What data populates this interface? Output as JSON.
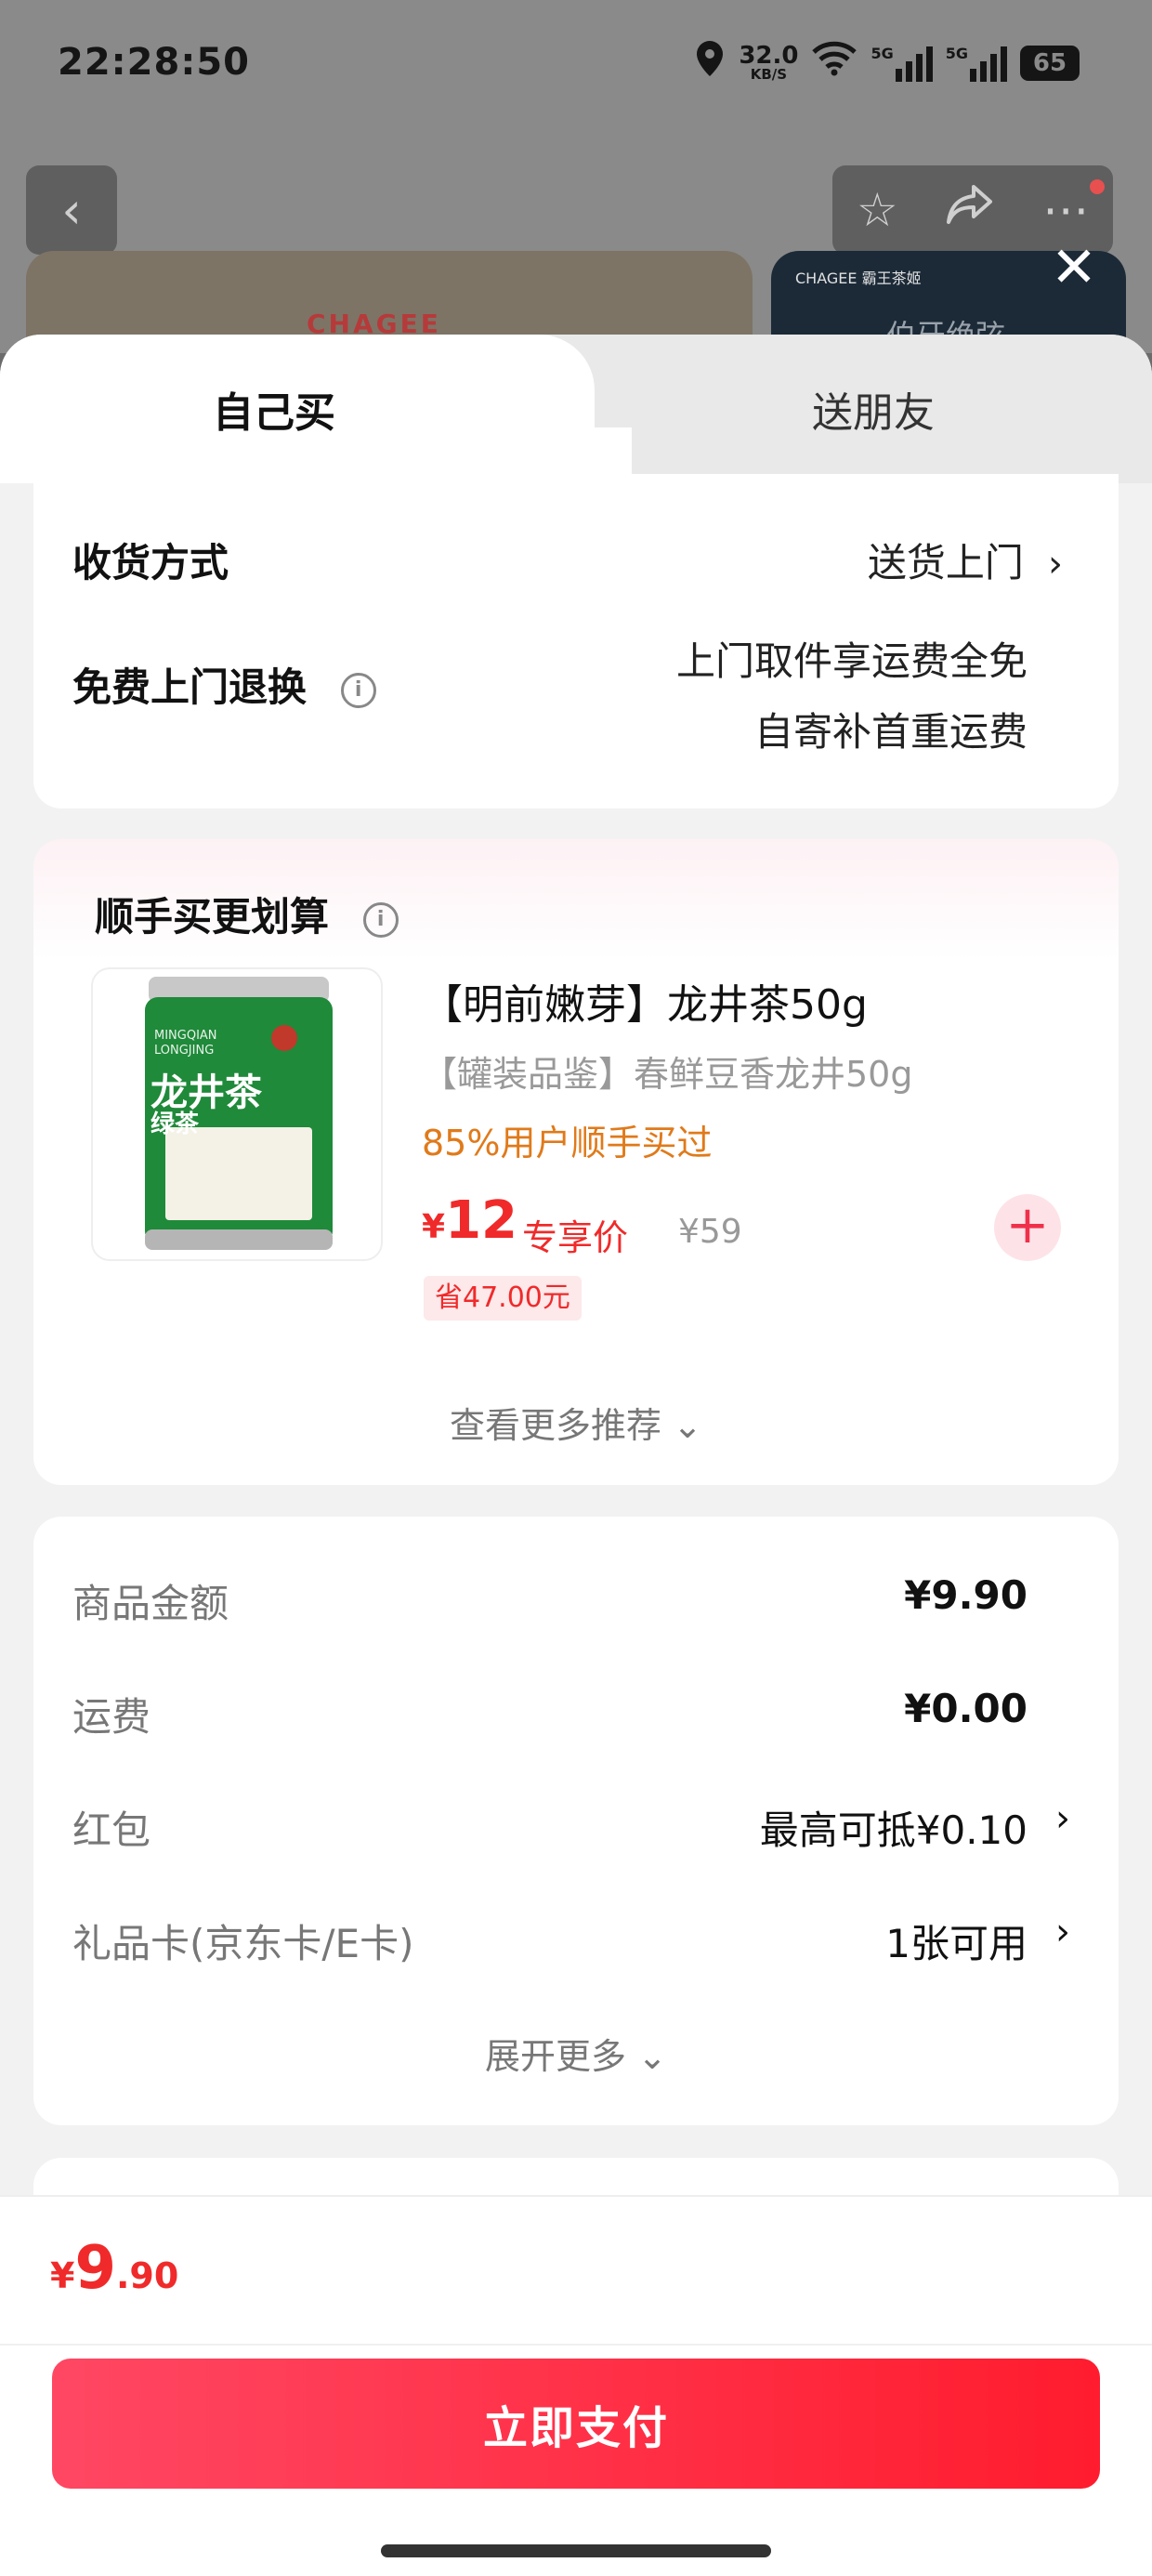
{
  "status_bar": {
    "time": "22:28:50",
    "net_speed": "32.0",
    "net_unit": "KB/S",
    "signal1": "5G",
    "signal2": "5G",
    "battery": "65"
  },
  "background": {
    "card1_logo": "CHAGEE",
    "card2_logo": "CHAGEE 霸王茶姬",
    "card2_text": "伯牙绝弦"
  },
  "tabs": {
    "self": "自己买",
    "gift": "送朋友"
  },
  "delivery": {
    "method_label": "收货方式",
    "method_value": "送货上门",
    "return_label": "免费上门退换",
    "return_line1": "上门取件享运费全免",
    "return_line2": "自寄补首重运费"
  },
  "recommend": {
    "title": "顺手买更划算",
    "product_name": "【明前嫩芽】龙井茶50g",
    "product_sub": "【罐装品鉴】春鲜豆香龙井50g",
    "percent_text": "85%用户顺手买过",
    "price_symbol": "¥",
    "price": "12",
    "exclusive_label": "专享价",
    "original_price": "¥59",
    "save_text": "省47.00元",
    "add_symbol": "+",
    "more_text": "查看更多推荐 ⌄",
    "can_label_en": "MINGQIAN LONGJING",
    "can_label_cn": "龙井茶",
    "can_label_sub": "绿茶"
  },
  "summary": {
    "rows": [
      {
        "label": "商品金额",
        "value": "¥9.90"
      },
      {
        "label": "运费",
        "value": "¥0.00"
      },
      {
        "label": "红包",
        "value": "最高可抵¥0.10"
      },
      {
        "label": "礼品卡(京东卡/E卡)",
        "value": "1张可用"
      }
    ],
    "more_text": "展开更多 ⌄"
  },
  "bottom": {
    "yen": "¥",
    "total_int": "9",
    "total_dec": ".90",
    "pay_label": "立即支付"
  },
  "colors": {
    "accent": "#f02a2a",
    "pay_button": "#ff2a3d",
    "orange": "#e07a1a"
  }
}
